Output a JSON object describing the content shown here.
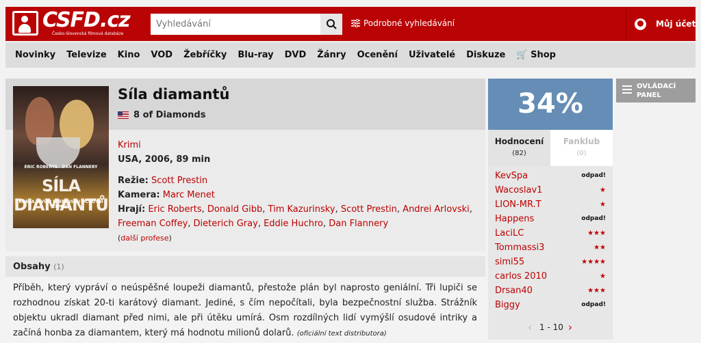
{
  "header": {
    "logo_text": "CSFD.cz",
    "logo_subtitle": "Česko-Slovenská filmová databáze",
    "search_placeholder": "Vyhledávání",
    "advanced_search": "Podrobné vyhledávání",
    "account": "Můj účet"
  },
  "nav": {
    "items": [
      "Novinky",
      "Televize",
      "Kino",
      "VOD",
      "Žebříčky",
      "Blu-ray",
      "DVD",
      "Žánry",
      "Ocenění",
      "Uživatelé",
      "Diskuze",
      "Shop"
    ]
  },
  "film": {
    "title": "Síla diamantů",
    "original_title": "8 of Diamonds",
    "genre": "Krimi",
    "origin": "USA, 2006, 89 min",
    "director_label": "Režie:",
    "director": "Scott Prestin",
    "camera_label": "Kamera:",
    "camera": "Marc Menet",
    "cast_label": "Hrají:",
    "cast": [
      "Eric Roberts",
      "Donald Gibb",
      "Tim Kazurinsky",
      "Scott Prestin",
      "Andrei Arlovski",
      "Freeman Coffey",
      "Dieterich Gray",
      "Eddie Huchro",
      "Dan Flannery"
    ],
    "more_professions": "další profese",
    "poster": {
      "actor_left": "ERIC ROBERTS",
      "actor_right": "DAN FLANNERY",
      "title": "SÍLA DIAMANTŮ",
      "tagline": "KRÁSA, KVŮLI KTERÉ JSOU OCHOTNÍ ZEMŘÍT",
      "format": "DVD"
    }
  },
  "plot": {
    "title": "Obsahy",
    "count": "(1)",
    "text": "Příběh, který vypráví o neúspěšné loupeži diamantů, přestože plán byl naprosto geniální. Tři lupiči se rozhodnou získat 20-ti karátový diamant. Jediné, s čím nepočítali, byla bezpečnostní služba. Strážník objektu ukradl diamant před nimi, ale při útěku umírá. Osm rozdílných lidí vymýšlí osudové intriky a začíná honba za diamantem, který má hodnotu milionů dolarů.",
    "source": "(oficiální text distributora)"
  },
  "rating": {
    "score": "34%",
    "tab_ratings": "Hodnocení",
    "ratings_count": "(82)",
    "tab_fanclub": "Fanklub",
    "fanclub_count": "(0)",
    "items": [
      {
        "user": "KevSpa",
        "value": "odpad!"
      },
      {
        "user": "Wacoslav1",
        "value": "★"
      },
      {
        "user": "LION-MR.T",
        "value": "★"
      },
      {
        "user": "Happens",
        "value": "odpad!"
      },
      {
        "user": "LaciLC",
        "value": "★★★"
      },
      {
        "user": "Tommassi3",
        "value": "★★"
      },
      {
        "user": "simi55",
        "value": "★★★★"
      },
      {
        "user": "carlos 2010",
        "value": "★"
      },
      {
        "user": "Drsan40",
        "value": "★★★"
      },
      {
        "user": "Biggy",
        "value": "odpad!"
      }
    ],
    "pager": "1 - 10"
  },
  "control_panel": "OVLÁDACÍ PANEL"
}
